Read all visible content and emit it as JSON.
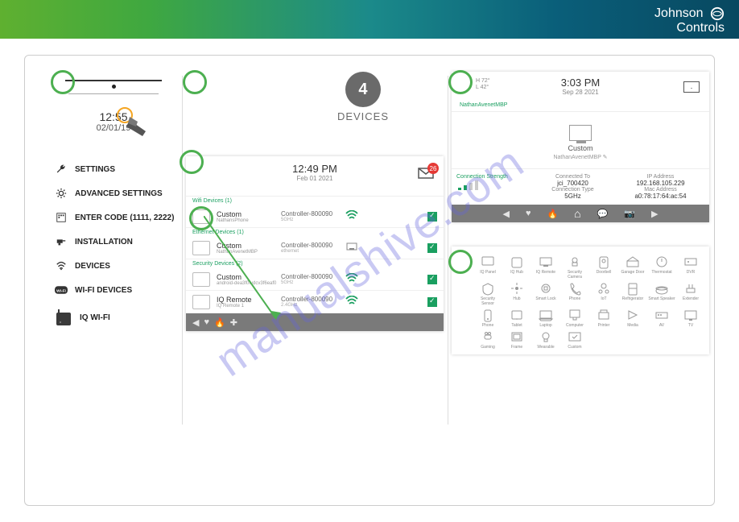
{
  "brand": {
    "line1": "Johnson",
    "line2": "Controls"
  },
  "panel1": {
    "clock_time": "12:55",
    "clock_date": "02/01/19",
    "menu": [
      {
        "label": "SETTINGS"
      },
      {
        "label": "ADVANCED SETTINGS"
      },
      {
        "label": "ENTER CODE (1111, 2222)"
      },
      {
        "label": "INSTALLATION"
      },
      {
        "label": "DEVICES"
      },
      {
        "label": "WI-FI DEVICES"
      },
      {
        "label": "IQ WI-FI"
      }
    ]
  },
  "panel2_badge": {
    "count": "4",
    "label": "DEVICES"
  },
  "device_list": {
    "time": "12:49 PM",
    "date": "Feb 01 2021",
    "mail_badge": "26",
    "sections": {
      "wifi": "Wifi Devices (1)",
      "ethernet": "Ethernet Devices (1)",
      "security": "Security Devices (2)"
    },
    "rows": [
      {
        "name": "Custom",
        "sub": "NathansPhone",
        "ctrl": "Controller-800090",
        "band": "5GHz",
        "conn": "wifi"
      },
      {
        "name": "Custom",
        "sub": "NathanAvenetMBP",
        "ctrl": "Controller-800090",
        "band": "ethernet",
        "conn": "eth"
      },
      {
        "name": "Custom",
        "sub": "android-dea3f0fvdcv3f6eaf0",
        "ctrl": "Controller-800090",
        "band": "5GHz",
        "conn": "wifi"
      },
      {
        "name": "IQ Remote",
        "sub": "IQ Remote 1",
        "ctrl": "Controller-800090",
        "band": "2.4GHz",
        "conn": "wifi"
      }
    ]
  },
  "detail": {
    "temp_hi": "H 72°",
    "temp_lo": "L 42°",
    "time": "3:03 PM",
    "date": "Sep 28 2021",
    "mbp": "NathanAvenetMBP",
    "center_label": "Custom",
    "center_sub": "NathanAvenetMBP ✎",
    "strength_label": "Connection Strength",
    "conn_to_lbl": "Connected To",
    "conn_to_val": "jci_700420",
    "conn_type_lbl": "Connection Type",
    "conn_type_val": "5GHz",
    "ip_lbl": "IP Address",
    "ip_val": "192.168.105.229",
    "mac_lbl": "Mac Address",
    "mac_val": "a0:78:17:64:ac:54"
  },
  "icon_grid": [
    "IQ Panel",
    "IQ Hub",
    "IQ Remote",
    "Security Camera",
    "Doorbell",
    "Garage Door",
    "Thermostat",
    "",
    "DVR",
    "Security Sensor",
    "Hub",
    "Smart Lock",
    "Phone",
    "IoT",
    "Refrigerator",
    "",
    "Smart Speaker",
    "Extender",
    "Phone",
    "Tablet",
    "Laptop",
    "Computer",
    "Printer",
    "",
    "Media",
    "AV",
    "TV",
    "Gaming",
    "Frame",
    "Wearable",
    "Custom",
    ""
  ],
  "watermark": "manualshive.com"
}
